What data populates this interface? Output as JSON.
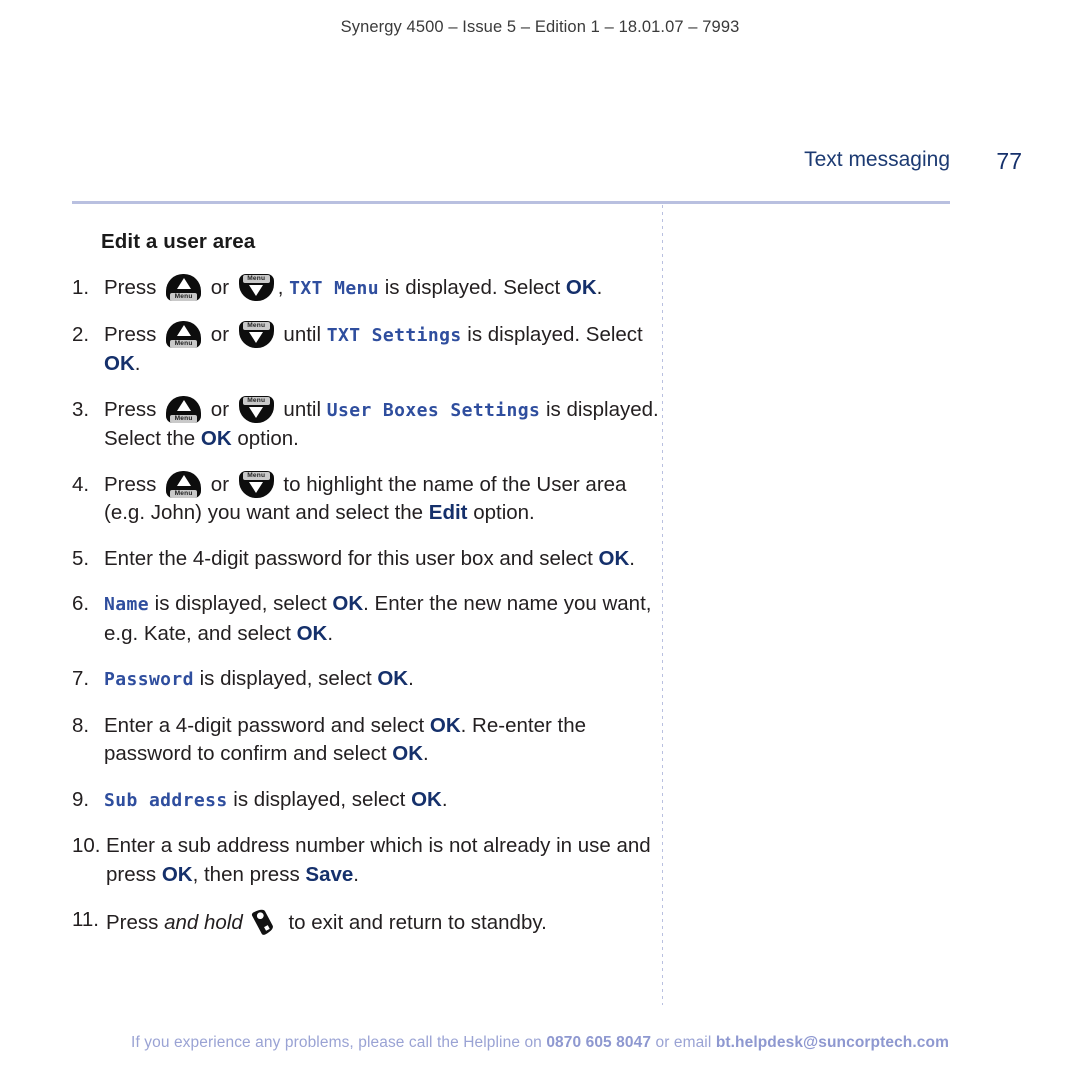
{
  "document": {
    "running_head": "Synergy 4500 – Issue 5 –  Edition 1 – 18.01.07 – 7993",
    "chapter_title": "Text messaging",
    "page_number": "77",
    "section_heading": "Edit a user area"
  },
  "icons": {
    "up_key_label": "Menu",
    "down_key_label": "Menu",
    "phone_icon_name": "handset-end-call-icon"
  },
  "steps": [
    {
      "number": "1.",
      "parts": [
        {
          "type": "text",
          "value": "Press "
        },
        {
          "type": "icon-up"
        },
        {
          "type": "text",
          "value": " or "
        },
        {
          "type": "icon-down"
        },
        {
          "type": "text",
          "value": ", "
        },
        {
          "type": "lcd",
          "value": "TXT Menu"
        },
        {
          "type": "text",
          "value": " is displayed. Select "
        },
        {
          "type": "key",
          "value": "OK"
        },
        {
          "type": "text",
          "value": "."
        }
      ]
    },
    {
      "number": "2.",
      "parts": [
        {
          "type": "text",
          "value": "Press "
        },
        {
          "type": "icon-up"
        },
        {
          "type": "text",
          "value": " or "
        },
        {
          "type": "icon-down"
        },
        {
          "type": "text",
          "value": " until "
        },
        {
          "type": "lcd",
          "value": "TXT Settings"
        },
        {
          "type": "text",
          "value": " is displayed. Select "
        },
        {
          "type": "key",
          "value": "OK"
        },
        {
          "type": "text",
          "value": "."
        }
      ]
    },
    {
      "number": "3.",
      "parts": [
        {
          "type": "text",
          "value": "Press "
        },
        {
          "type": "icon-up"
        },
        {
          "type": "text",
          "value": " or "
        },
        {
          "type": "icon-down"
        },
        {
          "type": "text",
          "value": " until "
        },
        {
          "type": "lcd",
          "value": "User Boxes Settings"
        },
        {
          "type": "text",
          "value": " is displayed. Select the "
        },
        {
          "type": "key",
          "value": "OK"
        },
        {
          "type": "text",
          "value": " option."
        }
      ]
    },
    {
      "number": "4.",
      "parts": [
        {
          "type": "text",
          "value": "Press "
        },
        {
          "type": "icon-up"
        },
        {
          "type": "text",
          "value": " or "
        },
        {
          "type": "icon-down"
        },
        {
          "type": "text",
          "value": " to highlight the name of the User area (e.g. John) you want and select the "
        },
        {
          "type": "key",
          "value": "Edit"
        },
        {
          "type": "text",
          "value": " option."
        }
      ]
    },
    {
      "number": "5.",
      "parts": [
        {
          "type": "text",
          "value": "Enter the 4-digit password for this user box and select "
        },
        {
          "type": "key",
          "value": "OK"
        },
        {
          "type": "text",
          "value": "."
        }
      ]
    },
    {
      "number": "6.",
      "parts": [
        {
          "type": "lcd",
          "value": "Name"
        },
        {
          "type": "text",
          "value": " is displayed, select "
        },
        {
          "type": "key",
          "value": "OK"
        },
        {
          "type": "text",
          "value": ". Enter the new name you want, e.g. Kate, and select "
        },
        {
          "type": "key",
          "value": "OK"
        },
        {
          "type": "text",
          "value": "."
        }
      ]
    },
    {
      "number": "7.",
      "parts": [
        {
          "type": "lcd",
          "value": "Password"
        },
        {
          "type": "text",
          "value": " is displayed, select "
        },
        {
          "type": "key",
          "value": "OK"
        },
        {
          "type": "text",
          "value": "."
        }
      ]
    },
    {
      "number": "8.",
      "parts": [
        {
          "type": "text",
          "value": "Enter a 4-digit password and select "
        },
        {
          "type": "key",
          "value": "OK"
        },
        {
          "type": "text",
          "value": ". Re-enter the password to confirm and select "
        },
        {
          "type": "key",
          "value": "OK"
        },
        {
          "type": "text",
          "value": "."
        }
      ]
    },
    {
      "number": "9.",
      "parts": [
        {
          "type": "lcd",
          "value": "Sub  address"
        },
        {
          "type": "text",
          "value": " is displayed, select "
        },
        {
          "type": "key",
          "value": "OK"
        },
        {
          "type": "text",
          "value": "."
        }
      ]
    },
    {
      "number": "10.",
      "wide": true,
      "parts": [
        {
          "type": "text",
          "value": "Enter a sub address number which is not already in use and press "
        },
        {
          "type": "key",
          "value": "OK"
        },
        {
          "type": "text",
          "value": ", then press "
        },
        {
          "type": "key",
          "value": "Save"
        },
        {
          "type": "text",
          "value": "."
        }
      ]
    },
    {
      "number": "11.",
      "wide": true,
      "parts": [
        {
          "type": "text",
          "value": "Press "
        },
        {
          "type": "italic",
          "value": "and hold"
        },
        {
          "type": "icon-phone"
        },
        {
          "type": "text",
          "value": " to exit and return to standby."
        }
      ]
    }
  ],
  "footer": {
    "lead": "If you experience any problems, please call the Helpline on ",
    "phone": "0870 605 8047",
    "middle": " or email ",
    "email": "bt.helpdesk@suncorptech.com"
  },
  "colors": {
    "chapter_blue": "#1c3a72",
    "key_blue": "#15306b",
    "lcd_blue": "#2f4e9e",
    "rule_blue": "#b9c0e0",
    "footer_blue": "#9aa3d4"
  }
}
